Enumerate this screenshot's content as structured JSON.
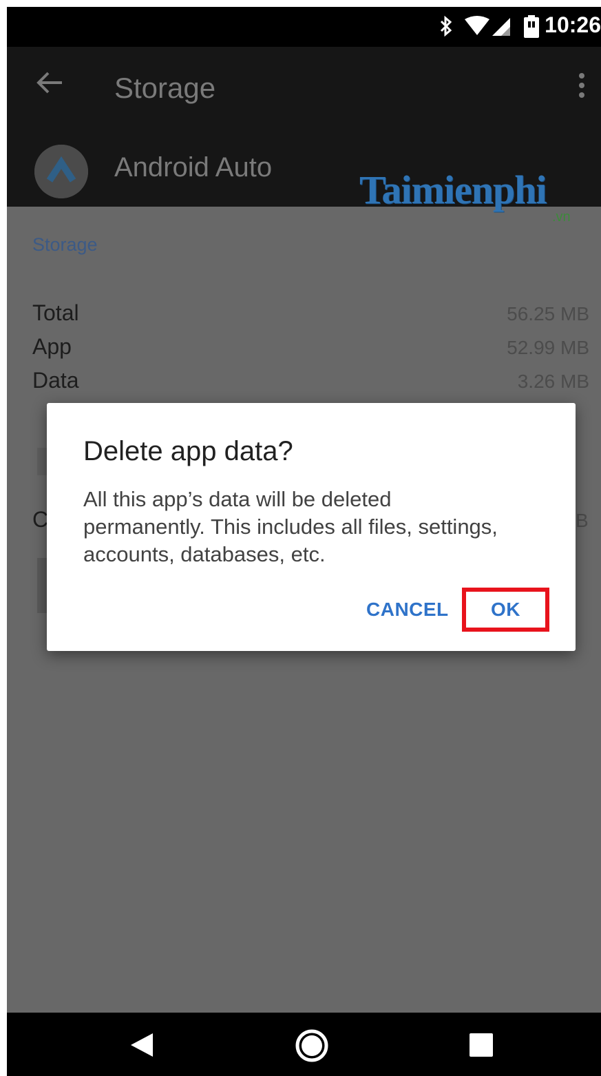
{
  "status_bar": {
    "time": "10:26",
    "icons": [
      "bluetooth-icon",
      "wifi-icon",
      "cellular-signal-icon",
      "battery-icon"
    ]
  },
  "header": {
    "title": "Storage",
    "back_icon": "arrow-left-icon",
    "menu_icon": "more-vert-icon"
  },
  "app": {
    "name": "Android Auto",
    "icon": "android-auto-icon"
  },
  "watermark": {
    "text": "Taimienphi",
    "sub": ".vn"
  },
  "storage": {
    "section_label": "Storage",
    "rows": [
      {
        "label": "Total",
        "value": "56.25 MB"
      },
      {
        "label": "App",
        "value": "52.99 MB"
      },
      {
        "label": "Data",
        "value": "3.26 MB"
      }
    ],
    "partial_left": "C",
    "partial_right": "B"
  },
  "dialog": {
    "title": "Delete app data?",
    "message": "All this app’s data will be deleted permanently. This includes all files, settings, accounts, databases, etc.",
    "cancel_label": "CANCEL",
    "ok_label": "OK",
    "highlight_color": "#e8131c",
    "button_color": "#2f73c9"
  },
  "nav_bar": {
    "icons": [
      "nav-back-icon",
      "nav-home-icon",
      "nav-recents-icon"
    ]
  }
}
